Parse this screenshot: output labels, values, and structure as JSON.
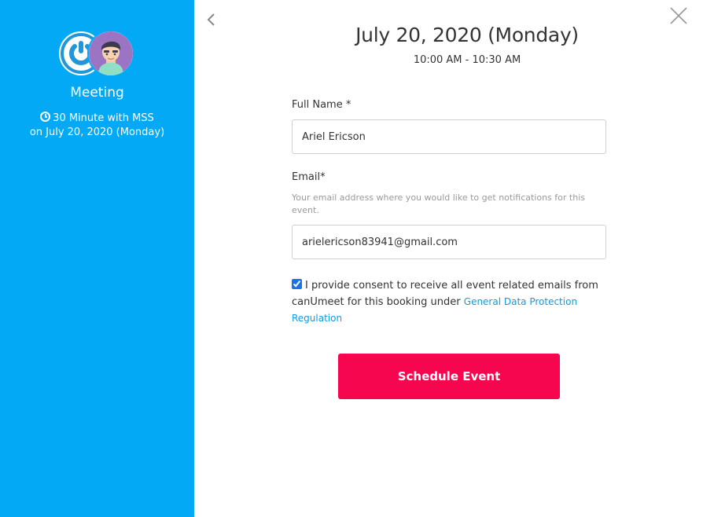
{
  "sidebar": {
    "logo_icon": "power-logo-icon",
    "avatar_icon": "user-avatar-icon",
    "meeting_title": "Meeting",
    "duration": "30 Minute with MSS",
    "duration_icon": "clock-icon",
    "date": "on July 20, 2020 (Monday)",
    "background_color": "#03a9f4"
  },
  "header": {
    "back_icon": "chevron-left-icon",
    "close_icon": "close-icon",
    "date_title": "July 20, 2020 (Monday)",
    "time_range": "10:00 AM - 10:30 AM"
  },
  "form": {
    "full_name_label": "Full Name *",
    "full_name_value": "Ariel Ericson",
    "email_label": "Email*",
    "email_help": "Your email address where you would like to get notifications for this event.",
    "email_value": "arielericson83941@gmail.com",
    "consent_checked": true,
    "consent_text": "I provide consent to receive all event related emails from canUmeet for this booking under",
    "consent_link": "General Data Protection Regulation",
    "submit_label": "Schedule Event",
    "submit_color": "#f5064f",
    "link_color": "#0e9be0"
  }
}
